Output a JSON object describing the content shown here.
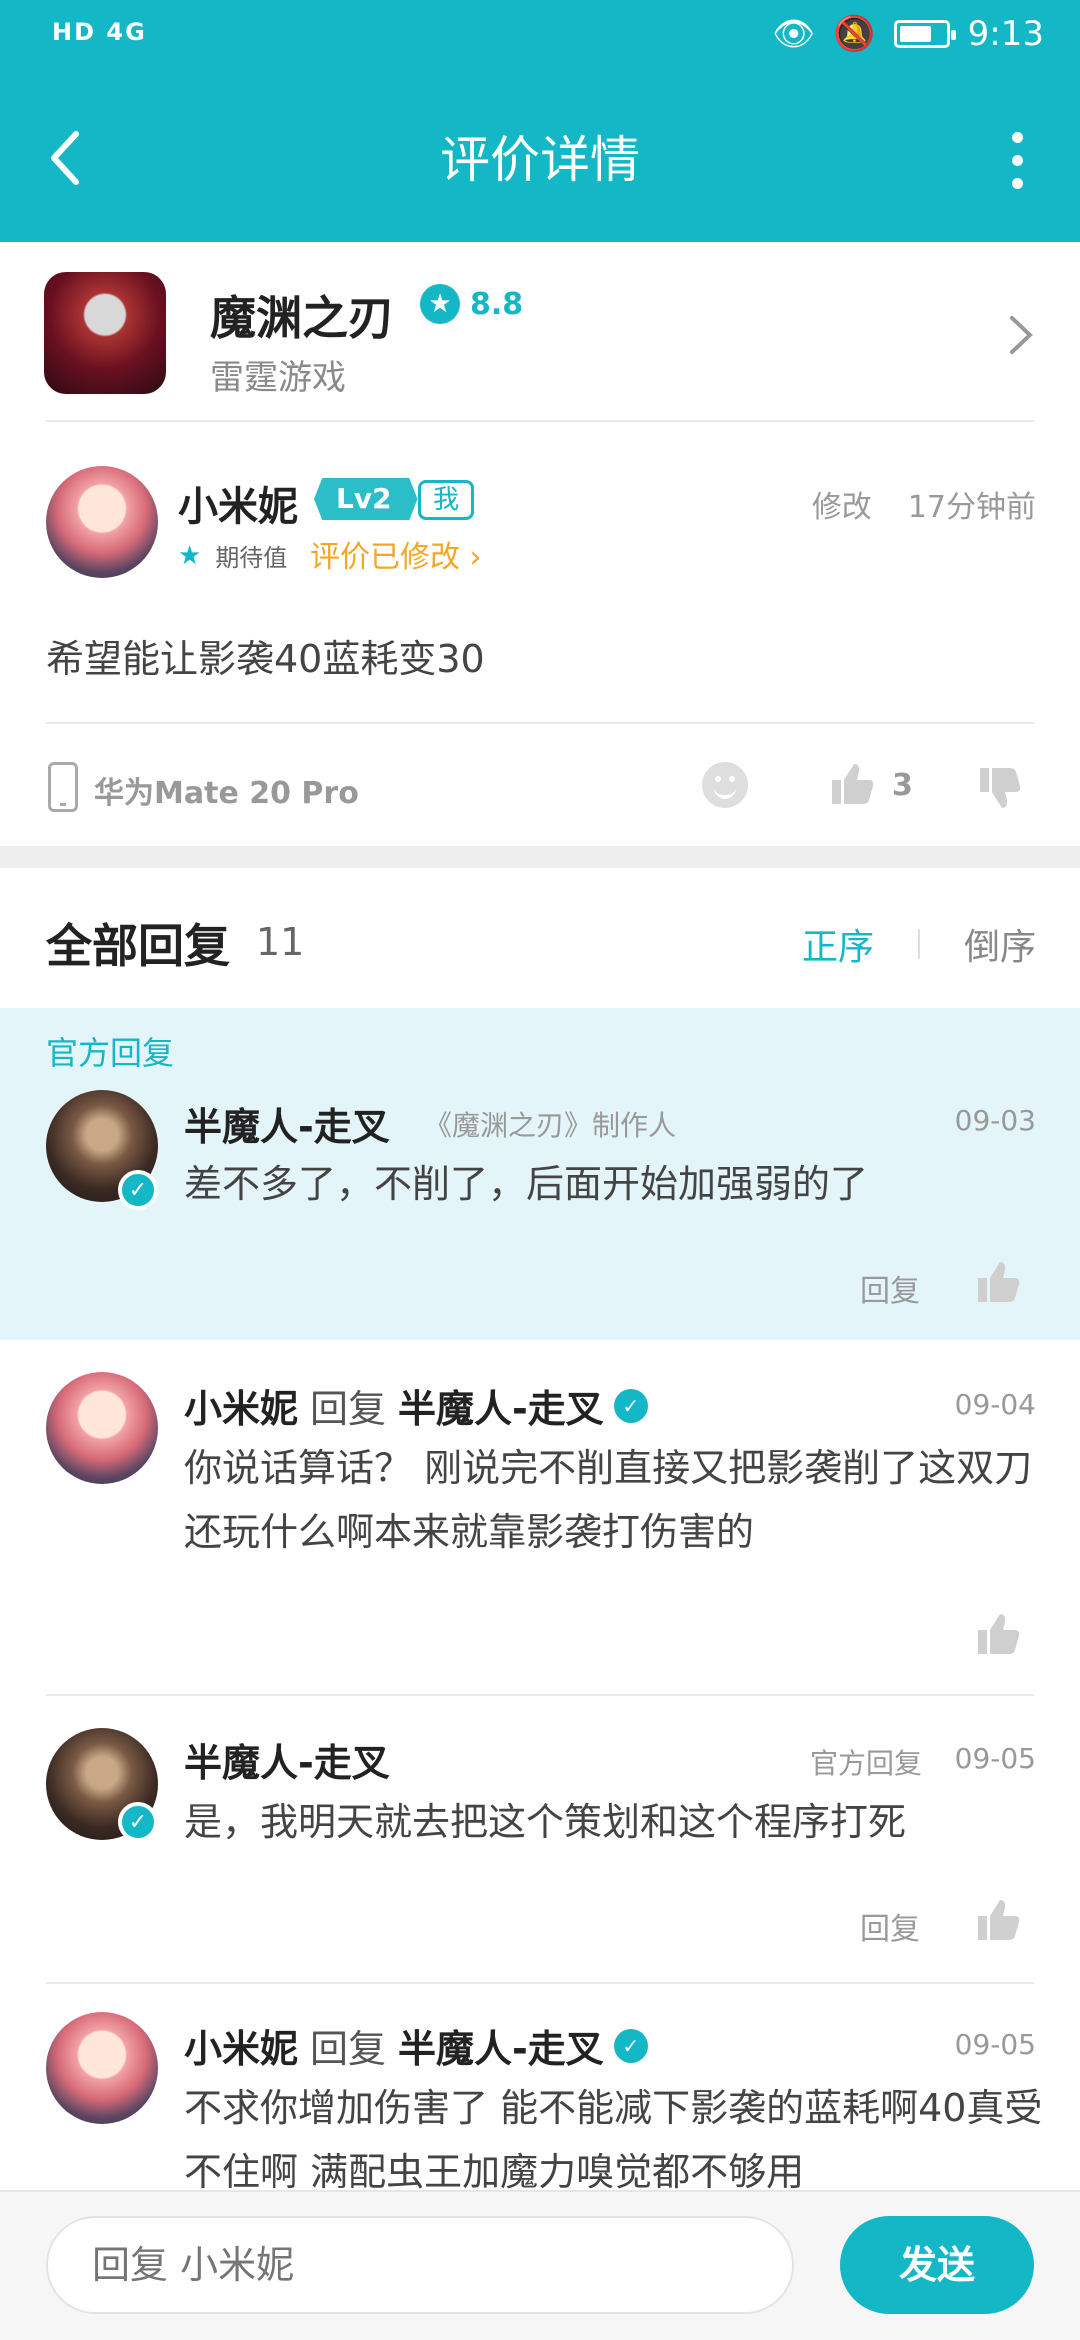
{
  "status_bar": {
    "left": "HD 4G",
    "time": "9:13",
    "battery_level": 0.7
  },
  "header": {
    "title": "评价详情"
  },
  "app": {
    "name": "魔渊之刃",
    "rating": "8.8",
    "developer": "雷霆游戏"
  },
  "review": {
    "user": "小米妮",
    "level": "Lv2",
    "me_tag": "我",
    "edit": "修改",
    "time": "17分钟前",
    "expect_label": "期待值",
    "edited_label": "评价已修改 ›",
    "text": "希望能让影袭40蓝耗变30",
    "device": "华为Mate 20 Pro",
    "likes": "3"
  },
  "replies_header": {
    "title": "全部回复",
    "count": "11",
    "sort_asc": "正序",
    "sort_desc": "倒序"
  },
  "replies": [
    {
      "section_label": "官方回复",
      "name": "半魔人-走叉",
      "role": "《魔渊之刃》制作人",
      "date": "09-03",
      "text": "差不多了，不削了，后面开始加强弱的了",
      "reply_label": "回复"
    },
    {
      "name": "小米妮",
      "reply_word": "回复",
      "target": "半魔人-走叉",
      "date": "09-04",
      "text": "你说话算话？ 刚说完不削直接又把影袭削了这双刀还玩什么啊本来就靠影袭打伤害的"
    },
    {
      "name": "半魔人-走叉",
      "tag": "官方回复",
      "date": "09-05",
      "text": "是，我明天就去把这个策划和这个程序打死",
      "reply_label": "回复"
    },
    {
      "name": "小米妮",
      "reply_word": "回复",
      "target": "半魔人-走叉",
      "date": "09-05",
      "text": "不求你增加伤害了 能不能减下影袭的蓝耗啊40真受不住啊 满配虫王加魔力嗅觉都不够用"
    }
  ],
  "bottom": {
    "placeholder": "回复 小米妮",
    "send": "发送"
  },
  "colors": {
    "accent": "#14b7c6",
    "official_bg": "#e3f5f9",
    "edited": "#f5a623"
  }
}
